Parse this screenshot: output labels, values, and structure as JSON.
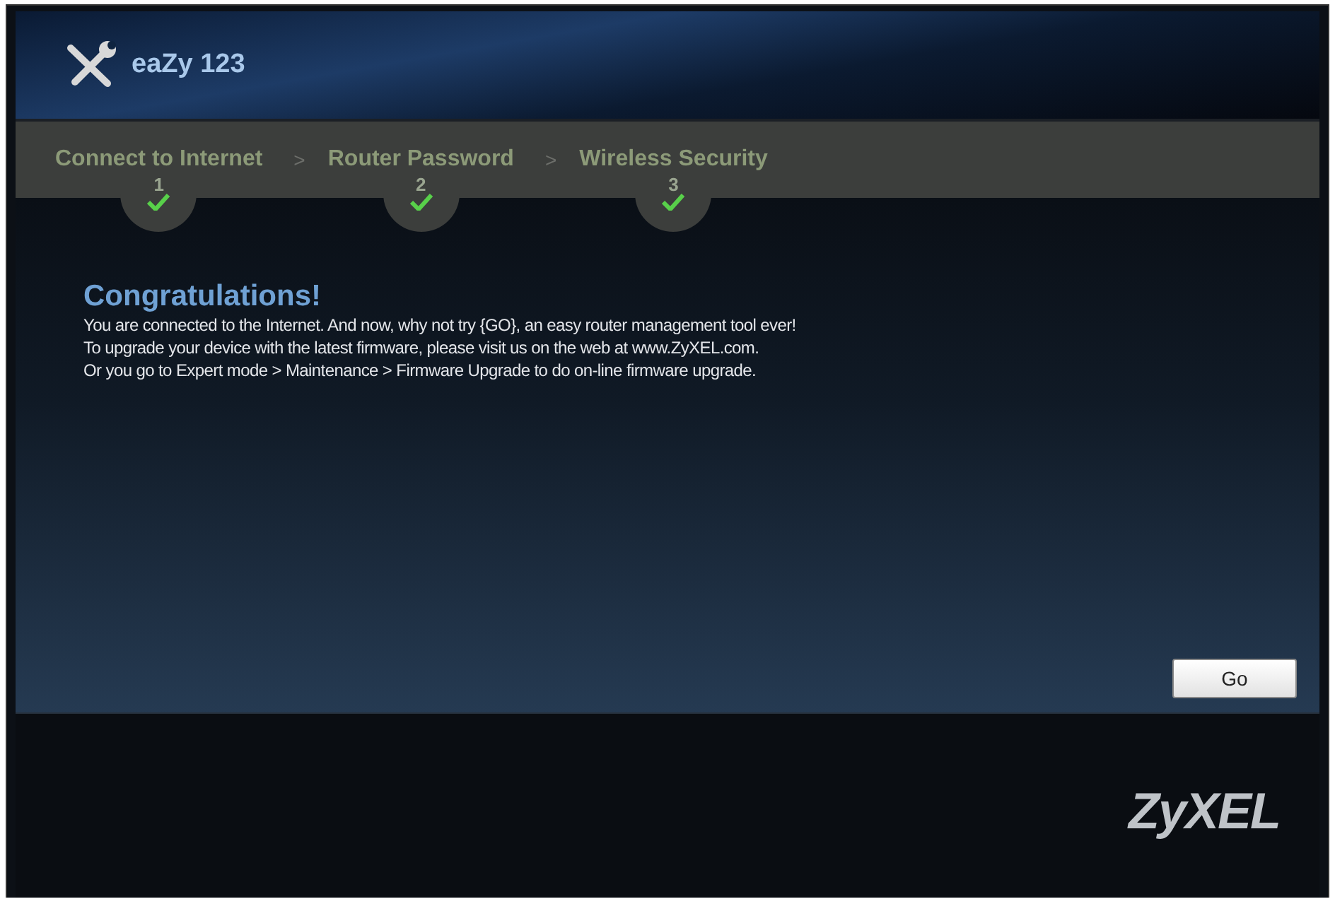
{
  "header": {
    "title": "eaZy 123"
  },
  "steps": [
    {
      "label": "Connect to Internet",
      "number": "1",
      "completed": true
    },
    {
      "label": "Router Password",
      "number": "2",
      "completed": true
    },
    {
      "label": "Wireless Security",
      "number": "3",
      "completed": true
    }
  ],
  "separator": ">",
  "message": {
    "heading": "Congratulations!",
    "lines": [
      "You are connected to the Internet. And now, why not try {GO}, an easy router management tool ever!",
      "To upgrade your device with the latest firmware, please visit us on the web at www.ZyXEL.com.",
      "Or you go to Expert mode > Maintenance > Firmware Upgrade to do on-line firmware upgrade."
    ]
  },
  "go_button": "Go",
  "footer": {
    "logo": "ZyXEL"
  }
}
